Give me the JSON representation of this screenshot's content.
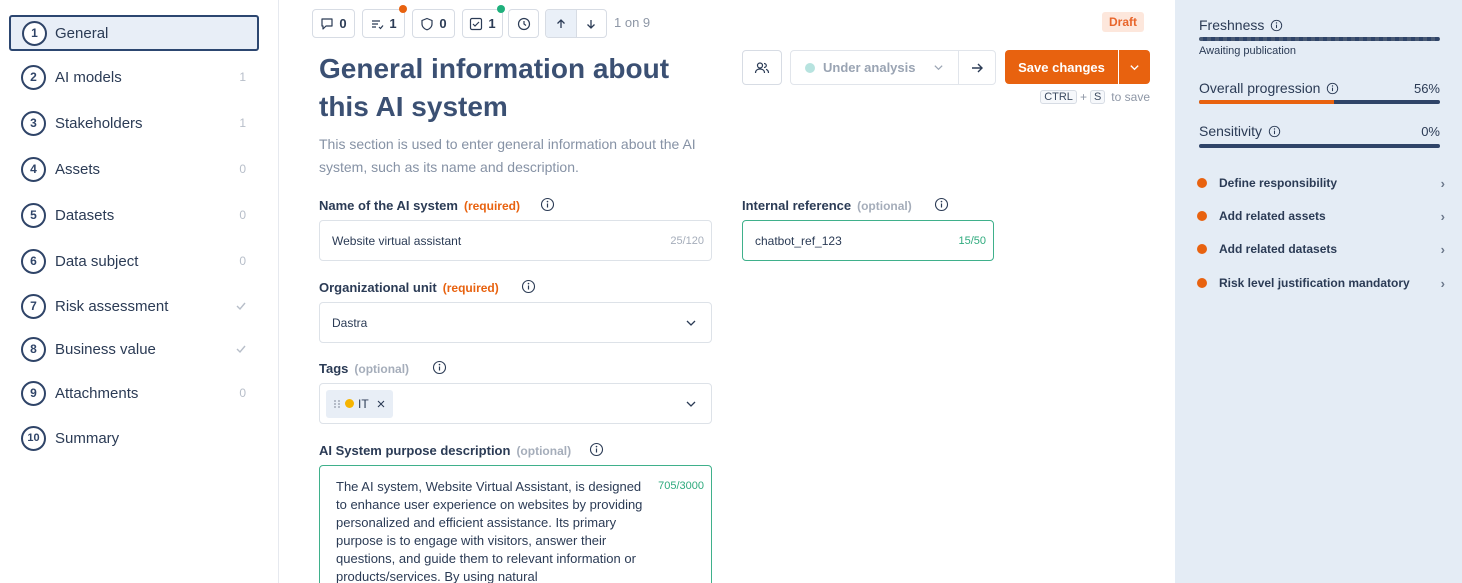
{
  "sidebar": {
    "items": [
      {
        "num": "1",
        "label": "General",
        "count": ""
      },
      {
        "num": "2",
        "label": "AI models",
        "count": "1"
      },
      {
        "num": "3",
        "label": "Stakeholders",
        "count": "1"
      },
      {
        "num": "4",
        "label": "Assets",
        "count": "0"
      },
      {
        "num": "5",
        "label": "Datasets",
        "count": "0"
      },
      {
        "num": "6",
        "label": "Data subject",
        "count": "0"
      },
      {
        "num": "7",
        "label": "Risk assessment",
        "count": "check"
      },
      {
        "num": "8",
        "label": "Business value",
        "count": "check"
      },
      {
        "num": "9",
        "label": "Attachments",
        "count": "0"
      },
      {
        "num": "10",
        "label": "Summary",
        "count": ""
      }
    ]
  },
  "toolbar": {
    "comments_count": "0",
    "tasks_count": "1",
    "shield_count": "0",
    "checks_count": "1",
    "pager": "1 on 9",
    "status_badge": "Draft",
    "badge_colors": {
      "tasks": "#e8620f",
      "checks": "#1fb07c"
    }
  },
  "header": {
    "title": "General information about this AI system",
    "description": "This section is used to enter general information about the AI system, such as its name and description."
  },
  "actions": {
    "status": "Under analysis",
    "save_label": "Save changes",
    "shortcut_ctrl": "CTRL",
    "shortcut_plus": "+",
    "shortcut_key": "S",
    "shortcut_suffix": "to save"
  },
  "form": {
    "name": {
      "label": "Name of the AI system",
      "tag": "(required)",
      "value": "Website virtual assistant",
      "counter": "25/120"
    },
    "internal_ref": {
      "label": "Internal reference",
      "tag": "(optional)",
      "value": "chatbot_ref_123",
      "counter": "15/50"
    },
    "org_unit": {
      "label": "Organizational unit",
      "tag": "(required)",
      "value": "Dastra"
    },
    "tags": {
      "label": "Tags",
      "tag": "(optional)",
      "chips": [
        "IT"
      ]
    },
    "purpose": {
      "label": "AI System purpose description",
      "tag": "(optional)",
      "counter": "705/3000",
      "value": "The AI system, Website Virtual Assistant, is designed to enhance user experience on websites by providing personalized and efficient assistance. Its primary purpose is to engage with visitors, answer their questions, and guide them to relevant information or products/services. By using natural"
    }
  },
  "right_panel": {
    "freshness": {
      "label": "Freshness",
      "sub": "Awaiting publication"
    },
    "progression": {
      "label": "Overall progression",
      "pct": "56%",
      "value": 0.56
    },
    "sensitivity": {
      "label": "Sensitivity",
      "pct": "0%",
      "value": 0
    },
    "todos": [
      {
        "label": "Define responsibility"
      },
      {
        "label": "Add related assets"
      },
      {
        "label": "Add related datasets"
      },
      {
        "label": "Risk level justification mandatory"
      }
    ]
  }
}
